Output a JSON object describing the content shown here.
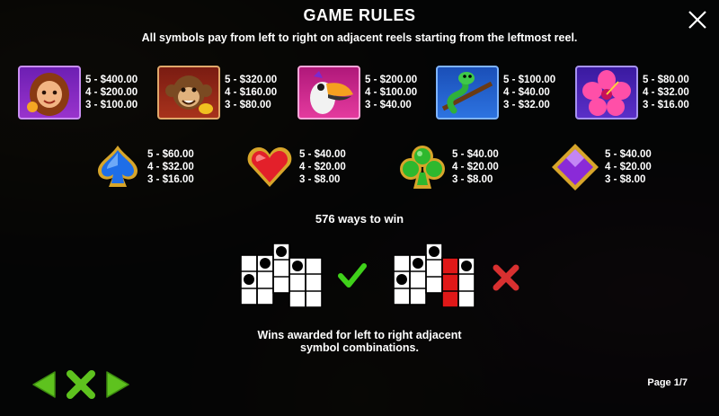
{
  "header": {
    "title": "GAME RULES",
    "subtitle": "All symbols pay from left to right on adjacent reels starting from the leftmost reel."
  },
  "symbols_row1": [
    {
      "name": "girl",
      "pays": [
        "5 - $400.00",
        "4 - $200.00",
        "3 - $100.00"
      ]
    },
    {
      "name": "monkey",
      "pays": [
        "5 - $320.00",
        "4 - $160.00",
        "3 - $80.00"
      ]
    },
    {
      "name": "toucan",
      "pays": [
        "5 - $200.00",
        "4 - $100.00",
        "3 - $40.00"
      ]
    },
    {
      "name": "snake",
      "pays": [
        "5 - $100.00",
        "4 - $40.00",
        "3 - $32.00"
      ]
    },
    {
      "name": "hibiscus",
      "pays": [
        "5 - $80.00",
        "4 - $32.00",
        "3 - $16.00"
      ]
    }
  ],
  "symbols_row2": [
    {
      "name": "spade",
      "pays": [
        "5 - $60.00",
        "4 - $32.00",
        "3 - $16.00"
      ]
    },
    {
      "name": "heart",
      "pays": [
        "5 - $40.00",
        "4 - $20.00",
        "3 - $8.00"
      ]
    },
    {
      "name": "club",
      "pays": [
        "5 - $40.00",
        "4 - $20.00",
        "3 - $8.00"
      ]
    },
    {
      "name": "diamond",
      "pays": [
        "5 - $40.00",
        "4 - $20.00",
        "3 - $8.00"
      ]
    }
  ],
  "ways": "576 ways to win",
  "description_line1": "Wins awarded for left to right adjacent",
  "description_line2": "symbol combinations.",
  "page": "Page 1/7",
  "colors": {
    "nav_green": "#5ec21e",
    "check_green": "#3fd11a",
    "cross_red": "#d83030",
    "highlight_red": "#e01818"
  },
  "icons": {
    "close": "close-icon",
    "prev": "arrow-left-icon",
    "next": "arrow-right-icon",
    "home": "x-home-icon"
  }
}
